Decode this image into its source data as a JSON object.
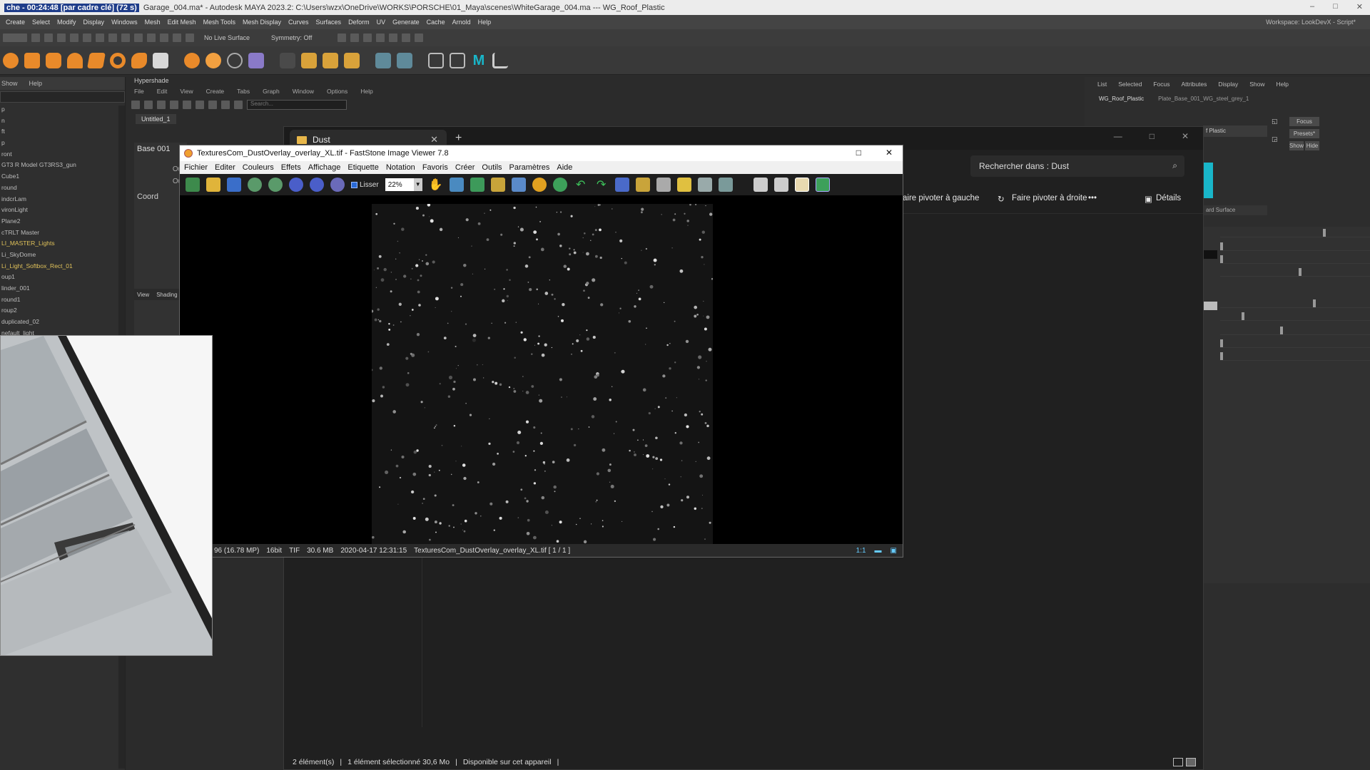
{
  "maya": {
    "title_highlight": "che - 00:24:48 [par cadre clé] (72 s)",
    "title": "Garage_004.ma* - Autodesk MAYA 2023.2: C:\\Users\\wzx\\OneDrive\\WORKS\\PORSCHE\\01_Maya\\scenes\\WhiteGarage_004.ma   ---   WG_Roof_Plastic",
    "menus": [
      "Create",
      "Select",
      "Modify",
      "Display",
      "Windows",
      "Mesh",
      "Edit Mesh",
      "Mesh Tools",
      "Mesh Display",
      "Curves",
      "Surfaces",
      "Deform",
      "UV",
      "Generate",
      "Cache",
      "Arnold",
      "Help"
    ],
    "workspace": "Workspace: LookDevX - Script*",
    "status": {
      "live_surface": "No Live Surface",
      "symmetry": "Symmetry: Off"
    },
    "shelf_icons": [
      "sphere-icon",
      "cube-icon",
      "cylinder-icon",
      "cone-icon",
      "plane-icon",
      "torus-icon",
      "sphere2-icon",
      "pipe-icon",
      "light-icon",
      "light2-icon",
      "globe-icon",
      "camera-icon",
      "select-icon",
      "move-icon",
      "rotate-icon",
      "scale-icon",
      "render-icon",
      "render2-icon",
      "ipr-icon",
      "settings-icon",
      "maya-logo-icon",
      "uv-icon"
    ]
  },
  "outliner": {
    "menu": [
      "Show",
      "Help"
    ],
    "items": [
      {
        "label": "p",
        "color": "white"
      },
      {
        "label": "n",
        "color": "white"
      },
      {
        "label": "ft",
        "color": "white"
      },
      {
        "label": "p",
        "color": "white"
      },
      {
        "label": "ront",
        "color": "white"
      },
      {
        "label": "GT3 R Model GT3RS3_gun",
        "color": "white"
      },
      {
        "label": "Cube1",
        "color": "white"
      },
      {
        "label": "round",
        "color": "white"
      },
      {
        "label": "indcrLam",
        "color": "white"
      },
      {
        "label": "vironLight",
        "color": "white"
      },
      {
        "label": "Plane2",
        "color": "white"
      },
      {
        "label": "cTRLT Master",
        "color": "white"
      },
      {
        "label": "LI_MASTER_Lights",
        "color": "yellow"
      },
      {
        "label": "Li_SkyDome",
        "color": "white"
      },
      {
        "label": "Li_Light_Softbox_Rect_01",
        "color": "yellow"
      },
      {
        "label": "oup1",
        "color": "white"
      },
      {
        "label": "linder_001",
        "color": "white"
      },
      {
        "label": "round1",
        "color": "white"
      },
      {
        "label": "roup2",
        "color": "white"
      },
      {
        "label": "duplicated_02",
        "color": "white"
      },
      {
        "label": "nefault_light",
        "color": "white"
      }
    ]
  },
  "hypershade": {
    "title": "Hypershade",
    "menus": [
      "File",
      "Edit",
      "View",
      "Create",
      "Tabs",
      "Graph",
      "Window",
      "Options",
      "Help"
    ],
    "search_placeholder": "Search...",
    "tab": "Untitled_1",
    "node_name": "Base 001",
    "ports": [
      "Out",
      "Out"
    ],
    "coord": "Coord",
    "bottom_tabs": [
      "View",
      "Shading"
    ]
  },
  "attribute_editor": {
    "menus": [
      "List",
      "Selected",
      "Focus",
      "Attributes",
      "Display",
      "Show",
      "Help"
    ],
    "tabs": [
      "WG_Roof_Plastic",
      "Plate_Base_001_WG_steel_grey_1"
    ],
    "name_field": "f Plastic",
    "buttons": [
      "Focus",
      "Presets*",
      "Show",
      "Hide"
    ],
    "surface_dropdown": "ard Surface",
    "slider_values": [
      0.72,
      0.0,
      0.0,
      0.55,
      0.65,
      0.15,
      0.42,
      0.0,
      0.0
    ]
  },
  "explorer": {
    "tab_title": "Dust",
    "search_placeholder": "Rechercher dans : Dust",
    "commands": {
      "rotate_left": "Faire pivoter à gauche",
      "rotate_right": "Faire pivoter à droite",
      "more": "•••",
      "details": "Détails"
    },
    "status": {
      "count": "2 élément(s)",
      "selected": "1 élément sélectionné  30,6 Mo",
      "availability": "Disponible sur cet appareil"
    }
  },
  "faststone": {
    "title": "TexturesCom_DustOverlay_overlay_XL.tif  -  FastStone Image Viewer 7.8",
    "menus": [
      "Fichier",
      "Editer",
      "Couleurs",
      "Effets",
      "Affichage",
      "Etiquette",
      "Notation",
      "Favoris",
      "Créer",
      "Outils",
      "Paramètres",
      "Aide"
    ],
    "smooth_label": "Lisser",
    "zoom": "22%",
    "status": [
      "96 (16.78 MP)",
      "16bit",
      "TIF",
      "30.6 MB",
      "2020-04-17 12:31:15",
      "TexturesCom_DustOverlay_overlay_XL.tif [ 1 / 1 ]"
    ],
    "status_right": "1:1"
  },
  "colors": {
    "accent": "#2a6ad6",
    "folder": "#e8b74a",
    "maya_blue": "#1f3d8a",
    "cyan": "#19b6c9"
  }
}
